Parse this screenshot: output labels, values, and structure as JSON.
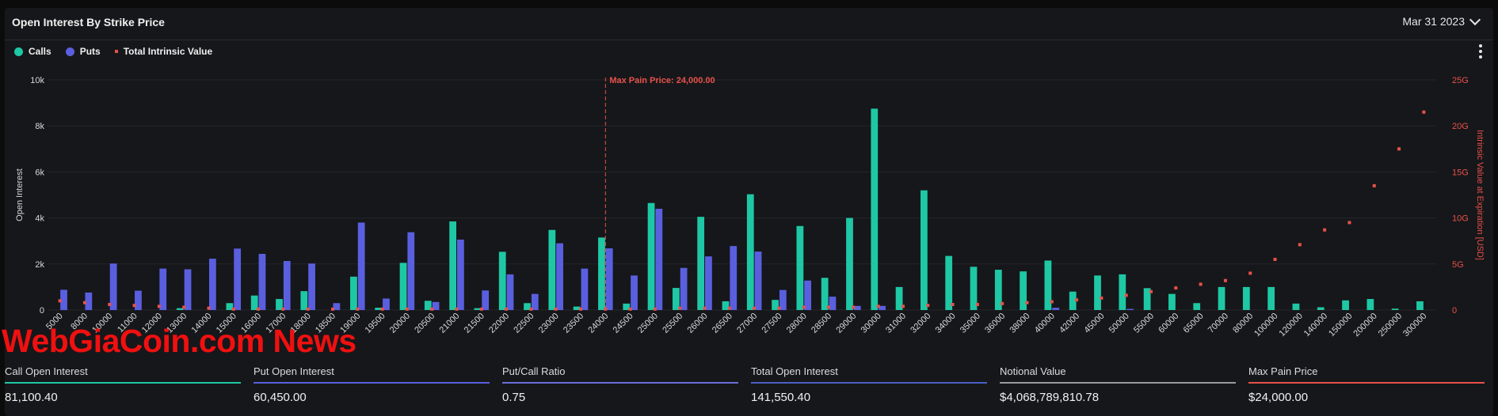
{
  "header": {
    "title": "Open Interest By Strike Price",
    "date": "Mar 31 2023"
  },
  "legend": {
    "calls": "Calls",
    "puts": "Puts",
    "intrinsic": "Total Intrinsic Value"
  },
  "colors": {
    "calls": "#1ec8a5",
    "puts": "#5a5fe0",
    "intrinsic": "#e8514a",
    "maxpain": "#e8514a"
  },
  "watermark": "WebGiaCoin.com News",
  "chart_data": {
    "type": "bar",
    "title": "Open Interest By Strike Price",
    "ylabel": "Open Interest",
    "y2label": "Intrinsic Value at Expiration [USD]",
    "ylim": [
      0,
      10000
    ],
    "y2lim": [
      0,
      25
    ],
    "yticks": [
      "0",
      "2k",
      "4k",
      "6k",
      "8k",
      "10k"
    ],
    "y2ticks": [
      "0",
      "5G",
      "10G",
      "15G",
      "20G",
      "25G"
    ],
    "grid": true,
    "legend_position": "top-left",
    "categories": [
      "5000",
      "8000",
      "10000",
      "11000",
      "12000",
      "13000",
      "14000",
      "15000",
      "16000",
      "17000",
      "18000",
      "18500",
      "19000",
      "19500",
      "20000",
      "20500",
      "21000",
      "21500",
      "22000",
      "22500",
      "23000",
      "23500",
      "24000",
      "24500",
      "25000",
      "25500",
      "26000",
      "26500",
      "27000",
      "27500",
      "28000",
      "28500",
      "29000",
      "30000",
      "31000",
      "32000",
      "34000",
      "35000",
      "36000",
      "38000",
      "40000",
      "42000",
      "45000",
      "50000",
      "55000",
      "60000",
      "65000",
      "70000",
      "80000",
      "100000",
      "120000",
      "140000",
      "150000",
      "200000",
      "250000",
      "300000"
    ],
    "series": [
      {
        "name": "Calls",
        "values": [
          0,
          0,
          0,
          0,
          0,
          80,
          0,
          300,
          630,
          480,
          820,
          0,
          1450,
          100,
          2050,
          400,
          3850,
          80,
          2530,
          300,
          3480,
          150,
          3150,
          280,
          4650,
          960,
          4050,
          380,
          5030,
          440,
          3650,
          1400,
          4000,
          8750,
          1000,
          5200,
          2350,
          1880,
          1750,
          1680,
          2150,
          800,
          1500,
          1550,
          950,
          700,
          300,
          1000,
          1000,
          1000,
          280,
          120,
          420,
          480,
          60,
          380
        ]
      },
      {
        "name": "Puts",
        "values": [
          880,
          760,
          2020,
          840,
          1800,
          1770,
          2230,
          2670,
          2440,
          2130,
          2020,
          300,
          3800,
          500,
          3380,
          350,
          3060,
          850,
          1550,
          700,
          2900,
          1800,
          2680,
          1500,
          4400,
          1830,
          2330,
          2780,
          2540,
          870,
          1280,
          580,
          180,
          180,
          0,
          0,
          0,
          0,
          0,
          0,
          100,
          0,
          0,
          50,
          0,
          0,
          0,
          0,
          0,
          0,
          0,
          0,
          0,
          0,
          0,
          0
        ]
      },
      {
        "name": "Total Intrinsic Value",
        "axis": "y2",
        "values": [
          1.0,
          0.8,
          0.6,
          0.5,
          0.4,
          0.3,
          0.2,
          0.1,
          0.1,
          0.1,
          0.1,
          0.1,
          0.1,
          0.1,
          0.1,
          0.1,
          0.1,
          0.1,
          0.1,
          0.1,
          0.1,
          0.1,
          0.1,
          0.1,
          0.1,
          0.2,
          0.2,
          0.2,
          0.2,
          0.2,
          0.3,
          0.3,
          0.3,
          0.4,
          0.4,
          0.5,
          0.6,
          0.6,
          0.7,
          0.8,
          0.9,
          1.1,
          1.3,
          1.6,
          2.0,
          2.4,
          2.8,
          3.2,
          4.0,
          5.5,
          7.1,
          8.7,
          9.5,
          13.5,
          17.5,
          21.5
        ]
      }
    ],
    "max_pain_category": "24000",
    "max_pain_label": "Max Pain Price: 24,000.00"
  },
  "stats": [
    {
      "label": "Call Open Interest",
      "value": "81,100.40",
      "color": "#1ec8a5"
    },
    {
      "label": "Put Open Interest",
      "value": "60,450.00",
      "color": "#5a5fe0"
    },
    {
      "label": "Put/Call Ratio",
      "value": "0.75",
      "color": "#6a6fd8"
    },
    {
      "label": "Total Open Interest",
      "value": "141,550.40",
      "color": "#4a60c8"
    },
    {
      "label": "Notional Value",
      "value": "$4,068,789,810.78",
      "color": "#9a9aa0"
    },
    {
      "label": "Max Pain Price",
      "value": "$24,000.00",
      "color": "#e8514a"
    }
  ]
}
